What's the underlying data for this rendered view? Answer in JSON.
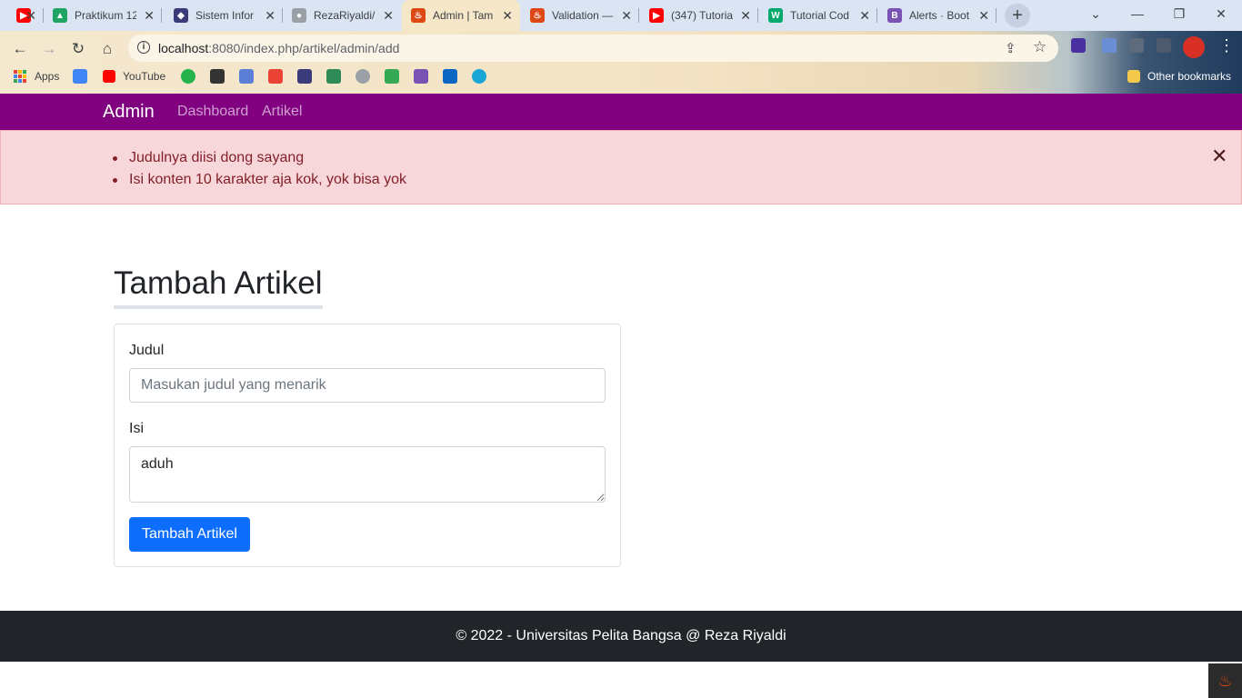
{
  "browser": {
    "tabs": [
      {
        "title": "",
        "favicon": "youtube-icon",
        "color": "#ff0000",
        "glyph": "▶"
      },
      {
        "title": "Praktikum 12",
        "favicon": "google-drive-icon",
        "color": "#1fa463",
        "glyph": "▲"
      },
      {
        "title": "Sistem Infor",
        "favicon": "university-icon",
        "color": "#3b3b7a",
        "glyph": "◆"
      },
      {
        "title": "RezaRiyaldi/",
        "favicon": "github-icon",
        "color": "#9aa0a6",
        "glyph": "●"
      },
      {
        "title": "Admin | Tam",
        "favicon": "codeigniter-icon",
        "color": "#dd4814",
        "glyph": "♨"
      },
      {
        "title": "Validation —",
        "favicon": "codeigniter-icon",
        "color": "#dd4814",
        "glyph": "♨"
      },
      {
        "title": "(347) Tutoria",
        "favicon": "youtube-icon",
        "color": "#ff0000",
        "glyph": "▶"
      },
      {
        "title": "Tutorial Cod",
        "favicon": "w3schools-icon",
        "color": "#04aa6d",
        "glyph": "W"
      },
      {
        "title": "Alerts · Boot",
        "favicon": "bootstrap-icon",
        "color": "#7952b3",
        "glyph": "B"
      }
    ],
    "active_tab": 4,
    "url_host": "localhost",
    "url_path": ":8080/index.php/artikel/admin/add",
    "bookmarks": {
      "apps": "Apps",
      "youtube": "YouTube",
      "other": "Other bookmarks"
    }
  },
  "navbar": {
    "brand": "Admin",
    "links": [
      "Dashboard",
      "Artikel"
    ],
    "color": "#800080"
  },
  "alert": {
    "errors": [
      "Judulnya diisi dong sayang",
      "Isi konten 10 karakter aja kok, yok bisa yok"
    ]
  },
  "form": {
    "title": "Tambah Artikel",
    "judul_label": "Judul",
    "judul_placeholder": "Masukan judul yang menarik",
    "judul_value": "",
    "isi_label": "Isi",
    "isi_value": "aduh",
    "submit_label": "Tambah Artikel"
  },
  "footer": {
    "text": "© 2022 - Universitas Pelita Bangsa @ Reza Riyaldi"
  }
}
